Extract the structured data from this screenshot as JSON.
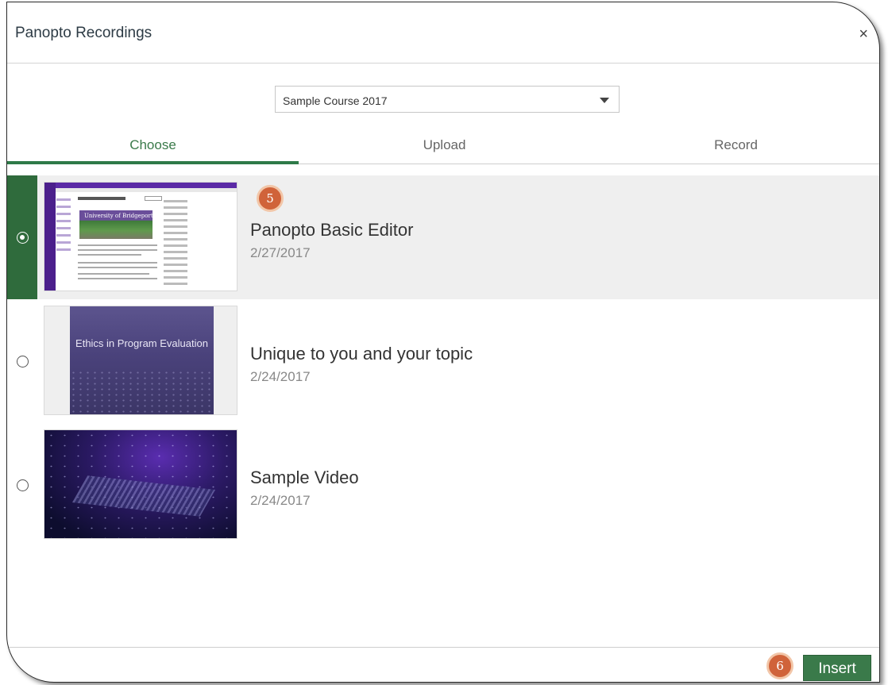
{
  "dialog": {
    "title": "Panopto Recordings",
    "close_symbol": "×"
  },
  "course_select": {
    "value": "Sample Course 2017"
  },
  "tabs": [
    {
      "label": "Choose",
      "active": true
    },
    {
      "label": "Upload",
      "active": false
    },
    {
      "label": "Record",
      "active": false
    }
  ],
  "recordings": [
    {
      "title": "Panopto Basic Editor",
      "date": "2/27/2017",
      "selected": true
    },
    {
      "title": "Unique to you and your topic",
      "date": "2/24/2017",
      "selected": false,
      "thumb_text": "Ethics in Program Evaluation"
    },
    {
      "title": "Sample Video",
      "date": "2/24/2017",
      "selected": false
    }
  ],
  "thumb1": {
    "banner_text": "University of Bridgeport"
  },
  "markers": [
    {
      "label": "5"
    },
    {
      "label": "6"
    }
  ],
  "footer": {
    "insert_label": "Insert"
  },
  "colors": {
    "accent_green": "#2f6b3c",
    "tab_active": "#3a7a4a",
    "marker_orange": "#d0633a"
  }
}
